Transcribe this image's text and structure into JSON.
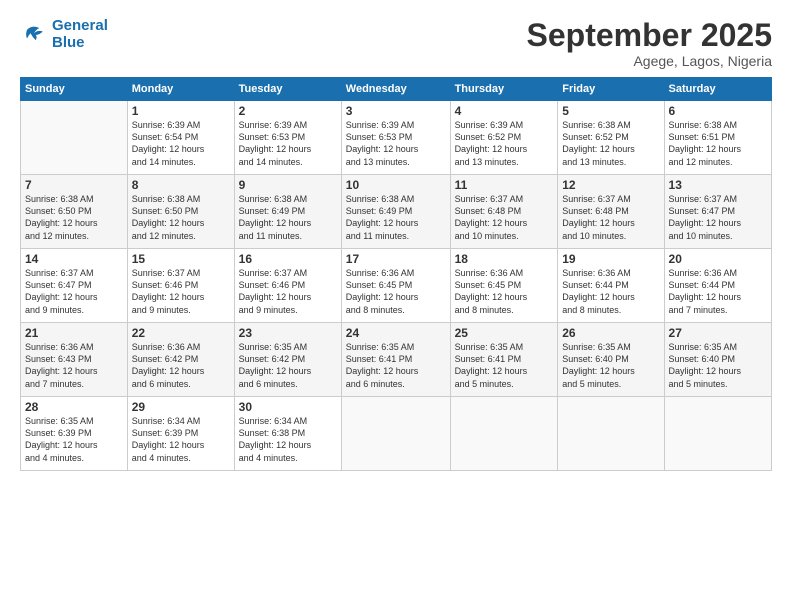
{
  "header": {
    "logo_line1": "General",
    "logo_line2": "Blue",
    "month": "September 2025",
    "location": "Agege, Lagos, Nigeria"
  },
  "weekdays": [
    "Sunday",
    "Monday",
    "Tuesday",
    "Wednesday",
    "Thursday",
    "Friday",
    "Saturday"
  ],
  "rows": [
    [
      {
        "day": "",
        "info": ""
      },
      {
        "day": "1",
        "info": "Sunrise: 6:39 AM\nSunset: 6:54 PM\nDaylight: 12 hours\nand 14 minutes."
      },
      {
        "day": "2",
        "info": "Sunrise: 6:39 AM\nSunset: 6:53 PM\nDaylight: 12 hours\nand 14 minutes."
      },
      {
        "day": "3",
        "info": "Sunrise: 6:39 AM\nSunset: 6:53 PM\nDaylight: 12 hours\nand 13 minutes."
      },
      {
        "day": "4",
        "info": "Sunrise: 6:39 AM\nSunset: 6:52 PM\nDaylight: 12 hours\nand 13 minutes."
      },
      {
        "day": "5",
        "info": "Sunrise: 6:38 AM\nSunset: 6:52 PM\nDaylight: 12 hours\nand 13 minutes."
      },
      {
        "day": "6",
        "info": "Sunrise: 6:38 AM\nSunset: 6:51 PM\nDaylight: 12 hours\nand 12 minutes."
      }
    ],
    [
      {
        "day": "7",
        "info": "Sunrise: 6:38 AM\nSunset: 6:50 PM\nDaylight: 12 hours\nand 12 minutes."
      },
      {
        "day": "8",
        "info": "Sunrise: 6:38 AM\nSunset: 6:50 PM\nDaylight: 12 hours\nand 12 minutes."
      },
      {
        "day": "9",
        "info": "Sunrise: 6:38 AM\nSunset: 6:49 PM\nDaylight: 12 hours\nand 11 minutes."
      },
      {
        "day": "10",
        "info": "Sunrise: 6:38 AM\nSunset: 6:49 PM\nDaylight: 12 hours\nand 11 minutes."
      },
      {
        "day": "11",
        "info": "Sunrise: 6:37 AM\nSunset: 6:48 PM\nDaylight: 12 hours\nand 10 minutes."
      },
      {
        "day": "12",
        "info": "Sunrise: 6:37 AM\nSunset: 6:48 PM\nDaylight: 12 hours\nand 10 minutes."
      },
      {
        "day": "13",
        "info": "Sunrise: 6:37 AM\nSunset: 6:47 PM\nDaylight: 12 hours\nand 10 minutes."
      }
    ],
    [
      {
        "day": "14",
        "info": "Sunrise: 6:37 AM\nSunset: 6:47 PM\nDaylight: 12 hours\nand 9 minutes."
      },
      {
        "day": "15",
        "info": "Sunrise: 6:37 AM\nSunset: 6:46 PM\nDaylight: 12 hours\nand 9 minutes."
      },
      {
        "day": "16",
        "info": "Sunrise: 6:37 AM\nSunset: 6:46 PM\nDaylight: 12 hours\nand 9 minutes."
      },
      {
        "day": "17",
        "info": "Sunrise: 6:36 AM\nSunset: 6:45 PM\nDaylight: 12 hours\nand 8 minutes."
      },
      {
        "day": "18",
        "info": "Sunrise: 6:36 AM\nSunset: 6:45 PM\nDaylight: 12 hours\nand 8 minutes."
      },
      {
        "day": "19",
        "info": "Sunrise: 6:36 AM\nSunset: 6:44 PM\nDaylight: 12 hours\nand 8 minutes."
      },
      {
        "day": "20",
        "info": "Sunrise: 6:36 AM\nSunset: 6:44 PM\nDaylight: 12 hours\nand 7 minutes."
      }
    ],
    [
      {
        "day": "21",
        "info": "Sunrise: 6:36 AM\nSunset: 6:43 PM\nDaylight: 12 hours\nand 7 minutes."
      },
      {
        "day": "22",
        "info": "Sunrise: 6:36 AM\nSunset: 6:42 PM\nDaylight: 12 hours\nand 6 minutes."
      },
      {
        "day": "23",
        "info": "Sunrise: 6:35 AM\nSunset: 6:42 PM\nDaylight: 12 hours\nand 6 minutes."
      },
      {
        "day": "24",
        "info": "Sunrise: 6:35 AM\nSunset: 6:41 PM\nDaylight: 12 hours\nand 6 minutes."
      },
      {
        "day": "25",
        "info": "Sunrise: 6:35 AM\nSunset: 6:41 PM\nDaylight: 12 hours\nand 5 minutes."
      },
      {
        "day": "26",
        "info": "Sunrise: 6:35 AM\nSunset: 6:40 PM\nDaylight: 12 hours\nand 5 minutes."
      },
      {
        "day": "27",
        "info": "Sunrise: 6:35 AM\nSunset: 6:40 PM\nDaylight: 12 hours\nand 5 minutes."
      }
    ],
    [
      {
        "day": "28",
        "info": "Sunrise: 6:35 AM\nSunset: 6:39 PM\nDaylight: 12 hours\nand 4 minutes."
      },
      {
        "day": "29",
        "info": "Sunrise: 6:34 AM\nSunset: 6:39 PM\nDaylight: 12 hours\nand 4 minutes."
      },
      {
        "day": "30",
        "info": "Sunrise: 6:34 AM\nSunset: 6:38 PM\nDaylight: 12 hours\nand 4 minutes."
      },
      {
        "day": "",
        "info": ""
      },
      {
        "day": "",
        "info": ""
      },
      {
        "day": "",
        "info": ""
      },
      {
        "day": "",
        "info": ""
      }
    ]
  ]
}
